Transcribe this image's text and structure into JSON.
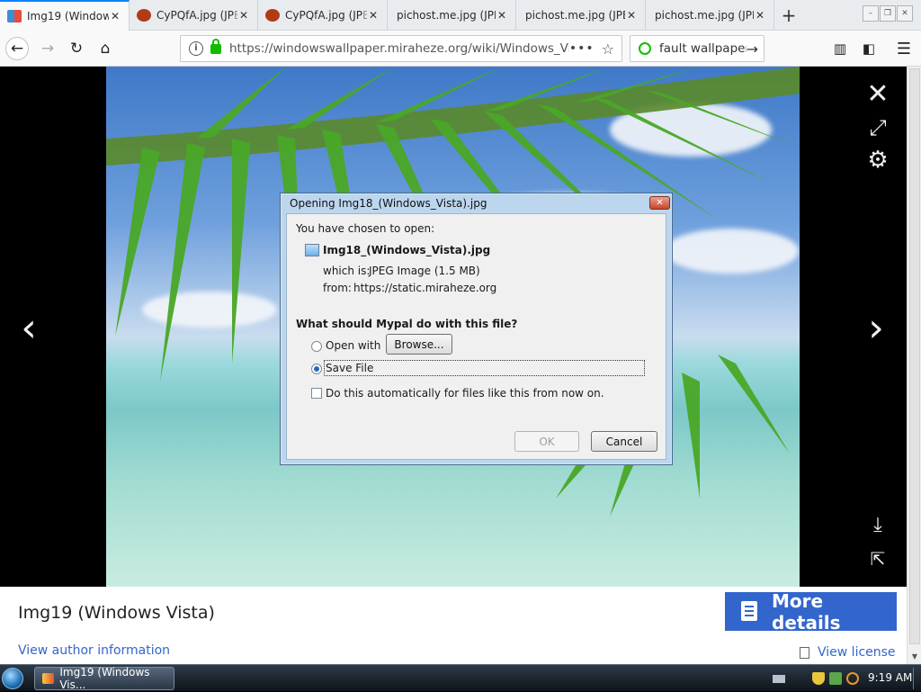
{
  "browser": {
    "tabs": [
      {
        "title": "Img19 (Window",
        "fade": "s",
        "favicon": "windows-logo",
        "active": true
      },
      {
        "title": "CyPQfA.jpg (JP",
        "fade": "EG",
        "favicon": "cat-icon",
        "active": false
      },
      {
        "title": "CyPQfA.jpg (JP",
        "fade": "EG",
        "favicon": "cat-icon",
        "active": false
      },
      {
        "title": "pichost.me.jpg (JPE",
        "fade": "G",
        "favicon": "none",
        "active": false
      },
      {
        "title": "pichost.me.jpg (JPE",
        "fade": "G",
        "favicon": "none",
        "active": false
      },
      {
        "title": "pichost.me.jpg (JPE",
        "fade": "G",
        "favicon": "none",
        "active": false
      }
    ],
    "url": "https://windowswallpaper.miraheze.org/wiki/Windows_Vis",
    "search_text": "fault wallpaper"
  },
  "lightbox": {
    "image_title": "Img19 (Windows Vista)",
    "more_details_label": "More details",
    "author_link": "View author information",
    "license_link": "View license"
  },
  "dialog": {
    "title": "Opening Img18_(Windows_Vista).jpg",
    "chosen_text": "You have chosen to open:",
    "filename": "Img18_(Windows_Vista).jpg",
    "which_is_label": "which is:",
    "which_is_value": "JPEG Image (1.5 MB)",
    "from_label": "from:",
    "from_value": "https://static.miraheze.org",
    "question": "What should Mypal do with this file?",
    "open_with_label": "Open with",
    "browse_label": "Browse...",
    "save_file_label": "Save File",
    "auto_label": "Do this automatically for files like this from now on.",
    "ok_label": "OK",
    "cancel_label": "Cancel",
    "selected_option": "save-file",
    "auto_checked": false
  },
  "taskbar": {
    "window_label": "Img19 (Windows Vis...",
    "clock": "9:19 AM"
  },
  "colors": {
    "accent_blue": "#3366cc",
    "tab_active_indicator": "#0a84ff",
    "secure_green": "#12bc00",
    "dialog_frame": "#bcd6ee"
  }
}
